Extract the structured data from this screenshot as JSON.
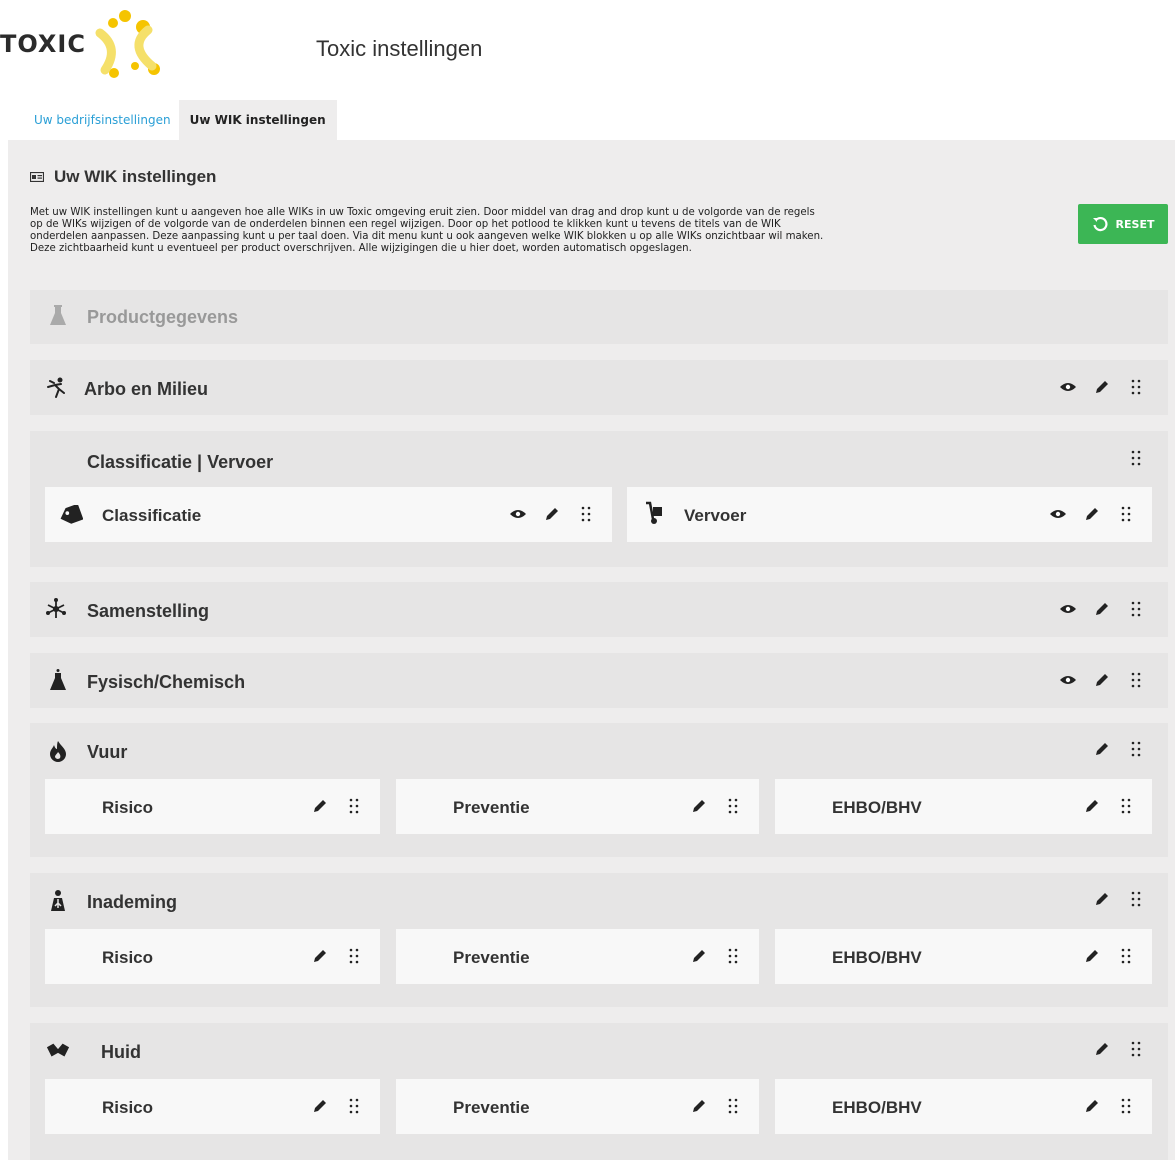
{
  "app": {
    "logo_text": "TOXIC",
    "title": "Toxic instellingen"
  },
  "tabs": [
    {
      "label": "Uw bedrijfsinstellingen",
      "active": false
    },
    {
      "label": "Uw WIK instellingen",
      "active": true
    }
  ],
  "section": {
    "title": "Uw WIK instellingen",
    "intro_lines": [
      "Met uw WIK instellingen kunt u aangeven hoe alle WIKs in uw Toxic omgeving eruit zien. Door middel van drag and drop kunt u de volgorde van de regels",
      "op de WIKs wijzigen of de volgorde van de onderdelen binnen een regel wijzigen. Door op het potlood te klikken kunt u tevens de titels van de WIK",
      "onderdelen aanpassen. Deze aanpassing kunt u per taal doen. Via dit menu kunt u ook aangeven welke WIK blokken u op alle WIKs onzichtbaar wil maken.",
      "Deze zichtbaarheid kunt u eventueel per product overschrijven. Alle wijzigingen die u hier doet, worden automatisch opgeslagen."
    ],
    "reset_label": "RESET"
  },
  "blocks": {
    "productgegevens": {
      "title": "Productgegevens",
      "icon": "flask-icon"
    },
    "arbo": {
      "title": "Arbo en Milieu",
      "icon": "person-running-icon"
    },
    "classificatie_group": {
      "title": "Classificatie | Vervoer"
    },
    "classificatie": {
      "title": "Classificatie",
      "icon": "tag-icon"
    },
    "vervoer": {
      "title": "Vervoer",
      "icon": "hand-truck-icon"
    },
    "samenstelling": {
      "title": "Samenstelling",
      "icon": "molecule-icon"
    },
    "fysisch": {
      "title": "Fysisch/Chemisch",
      "icon": "lab-flask-icon"
    },
    "vuur": {
      "title": "Vuur",
      "icon": "fire-icon"
    },
    "inademing": {
      "title": "Inademing",
      "icon": "lungs-icon"
    },
    "huid": {
      "title": "Huid",
      "icon": "hands-icon"
    },
    "sub_labels": {
      "risico": "Risico",
      "preventie": "Preventie",
      "ehbo": "EHBO/BHV"
    }
  },
  "colors": {
    "accent_blue": "#2a9fd6",
    "reset_green": "#3cb655",
    "logo_yellow": "#f5c400"
  }
}
